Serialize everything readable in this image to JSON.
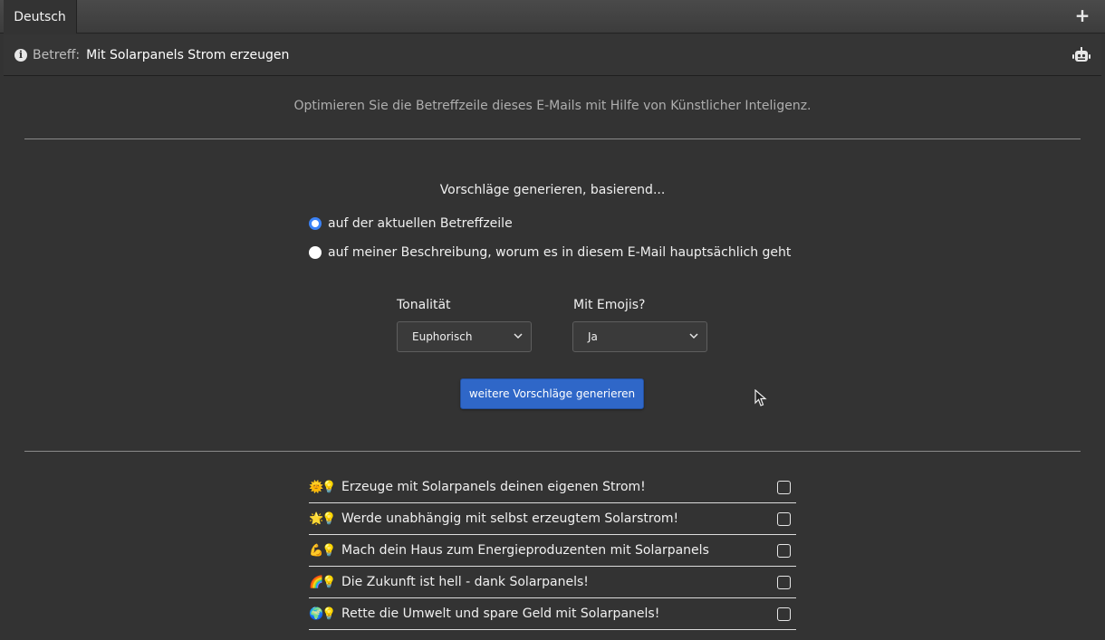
{
  "tabs": [
    {
      "label": "Deutsch"
    }
  ],
  "subject": {
    "label": "Betreff:",
    "value": "Mit Solarpanels Strom erzeugen"
  },
  "intro_text": "Optimieren Sie die Betreffzeile dieses E-Mails mit Hilfe von Künstlicher Inteligenz.",
  "generator": {
    "title": "Vorschläge generieren, basierend...",
    "options": [
      {
        "label": "auf der aktuellen Betreffzeile",
        "checked": true
      },
      {
        "label": "auf meiner Beschreibung, worum es in diesem E-Mail hauptsächlich geht",
        "checked": false
      }
    ],
    "tone": {
      "label": "Tonalität",
      "value": "Euphorisch"
    },
    "emojis": {
      "label": "Mit Emojis?",
      "value": "Ja"
    },
    "button_label": "weitere Vorschläge generieren"
  },
  "suggestions": [
    {
      "emoji": "🌞💡",
      "text": "Erzeuge mit Solarpanels deinen eigenen Strom!",
      "checked": false
    },
    {
      "emoji": "🌟💡",
      "text": "Werde unabhängig mit selbst erzeugtem Solarstrom!",
      "checked": false
    },
    {
      "emoji": "💪💡",
      "text": "Mach dein Haus zum Energieproduzenten mit Solarpanels",
      "checked": false
    },
    {
      "emoji": "🌈💡",
      "text": "Die Zukunft ist hell - dank Solarpanels!",
      "checked": false
    },
    {
      "emoji": "🌍💡",
      "text": "Rette die Umwelt und spare Geld mit Solarpanels!",
      "checked": false
    }
  ],
  "colors": {
    "accent": "#2f67c8",
    "background": "#333333",
    "radio_selected": "#3b82f6"
  },
  "icons": {
    "add": "plus-icon",
    "info": "info-icon",
    "assistant": "robot-icon",
    "dropdown": "chevron-down-icon"
  }
}
